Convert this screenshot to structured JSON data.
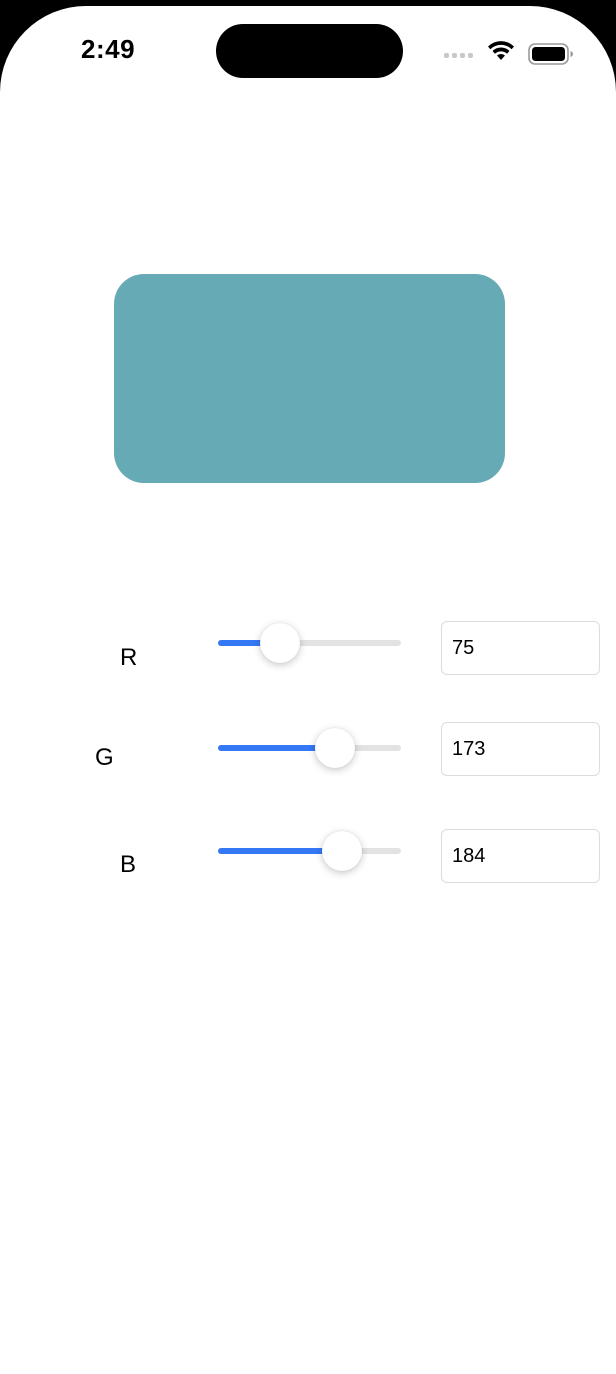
{
  "status_bar": {
    "time": "2:49",
    "icons": [
      "signal-icon",
      "wifi-icon",
      "battery-icon"
    ]
  },
  "preview": {
    "color": "#66aab6"
  },
  "colors": {
    "accent": "#3478f6",
    "track": "#e3e3e3"
  },
  "channels": [
    {
      "label": "R",
      "value": "75",
      "fraction": 0.34
    },
    {
      "label": "G",
      "value": "173",
      "fraction": 0.64
    },
    {
      "label": "B",
      "value": "184",
      "fraction": 0.68
    }
  ]
}
